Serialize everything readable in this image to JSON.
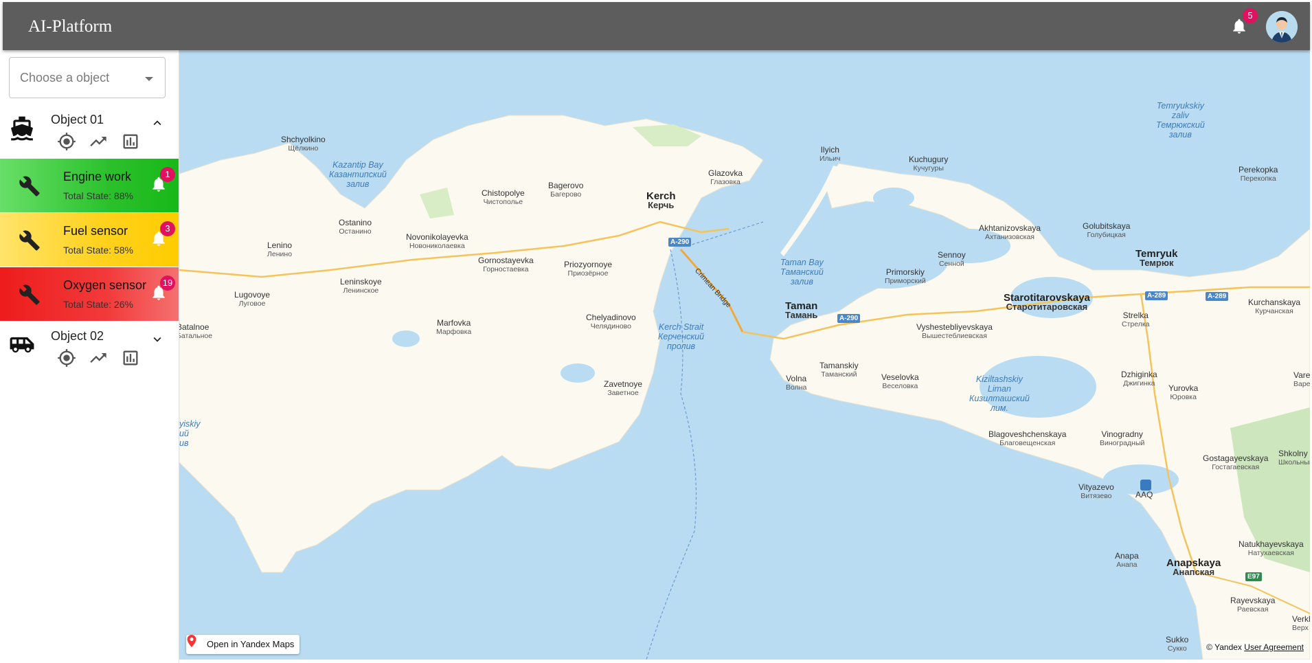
{
  "app": {
    "title": "AI-Platform",
    "notifications_count": "5"
  },
  "search": {
    "placeholder": "Choose a object"
  },
  "objects": [
    {
      "name": "Object 01",
      "icon": "ship-icon",
      "expanded": true,
      "sensors": [
        {
          "name": "Engine work",
          "state": "Total State: 88%",
          "state_value": 0.88,
          "alerts": "1",
          "color": "#2ecc40"
        },
        {
          "name": "Fuel sensor",
          "state": "Total State: 58%",
          "state_value": 0.58,
          "alerts": "3",
          "color": "#ffd21f"
        },
        {
          "name": "Oxygen sensor",
          "state": "Total State: 26%",
          "state_value": 0.26,
          "alerts": "19",
          "color": "#ee1b1b"
        }
      ]
    },
    {
      "name": "Object 02",
      "icon": "truck-icon",
      "expanded": false,
      "sensors": []
    }
  ],
  "map": {
    "open_link": "Open in Yandex Maps",
    "copyright": "© Yandex",
    "agreement": "User Agreement",
    "water_labels": [
      {
        "en": "Kazantip Bay",
        "ru1": "Казантипский",
        "ru2": "залив"
      },
      {
        "en": "Temryukskiy",
        "ru1": "zaliv",
        "ru2": "Темрюкский",
        "ru3": "залив"
      },
      {
        "en": "Taman Bay",
        "ru1": "Таманский",
        "ru2": "залив"
      },
      {
        "en": "Kerch Strait",
        "ru1": "Керченский",
        "ru2": "пролив"
      },
      {
        "en": "Kiziltashskiy",
        "ru1": "Liman",
        "ru2": "Кизилташский",
        "ru3": "лим."
      },
      {
        "en": "yiskiy",
        "ru1": "ий",
        "ru2": "ив"
      }
    ],
    "places": [
      {
        "en": "Shchyolkino",
        "ru": "Щёлкино"
      },
      {
        "en": "Glazovka",
        "ru": "Глазовка"
      },
      {
        "en": "Ilyich",
        "ru": "Ильич"
      },
      {
        "en": "Kuchugury",
        "ru": "Кучугуры"
      },
      {
        "en": "Perekopka",
        "ru": "Перекопка"
      },
      {
        "en": "Chistopolye",
        "ru": "Чистополье"
      },
      {
        "en": "Bagerovo",
        "ru": "Багерово"
      },
      {
        "en": "Ostanino",
        "ru": "Останино"
      },
      {
        "en": "Novonikolayevka",
        "ru": "Новониколаевка"
      },
      {
        "en": "Lenino",
        "ru": "Ленино"
      },
      {
        "en": "Gornostayevka",
        "ru": "Горностаевка"
      },
      {
        "en": "Priozyornoye",
        "ru": "Приозёрное"
      },
      {
        "en": "Leninskoye",
        "ru": "Ленинское"
      },
      {
        "en": "Lugovoye",
        "ru": "Луговое"
      },
      {
        "en": "Batalnoe",
        "ru": "Батальное"
      },
      {
        "en": "Marfovka",
        "ru": "Марфовка"
      },
      {
        "en": "Chelyadinovo",
        "ru": "Челядиново"
      },
      {
        "en": "Zavetnoye",
        "ru": "Заветное"
      },
      {
        "en": "Akhtanizovskaya",
        "ru": "Ахтанизовская"
      },
      {
        "en": "Golubitskaya",
        "ru": "Голубицкая"
      },
      {
        "en": "Sennoy",
        "ru": "Сенной"
      },
      {
        "en": "Primorskiy",
        "ru": "Приморский"
      },
      {
        "en": "Vyshestebliyevskaya",
        "ru": "Вышестеблиевская"
      },
      {
        "en": "Tamanskiy",
        "ru": "Таманский"
      },
      {
        "en": "Volna",
        "ru": "Волна"
      },
      {
        "en": "Veselovka",
        "ru": "Веселовка"
      },
      {
        "en": "Strelka",
        "ru": "Стрелка"
      },
      {
        "en": "Kurchanskaya",
        "ru": "Курчанская"
      },
      {
        "en": "Dzhiginka",
        "ru": "Джигинка"
      },
      {
        "en": "Yurovka",
        "ru": "Юровка"
      },
      {
        "en": "Varenikovskaya",
        "ru": "Варениковская"
      },
      {
        "en": "Blagoveshchenskaya",
        "ru": "Благовещенская"
      },
      {
        "en": "Vinogradny",
        "ru": "Виноградный"
      },
      {
        "en": "Gostagayevskaya",
        "ru": "Гостагаевская"
      },
      {
        "en": "Shkolny",
        "ru": "Школьный"
      },
      {
        "en": "Vityazevo",
        "ru": "Витязево"
      },
      {
        "en": "Natukhayevskaya",
        "ru": "Натухаевская"
      },
      {
        "en": "Anapa",
        "ru": "Анапа"
      },
      {
        "en": "Rayevskaya",
        "ru": "Раевская"
      },
      {
        "en": "Sukko",
        "ru": "Сукко"
      },
      {
        "en": "Verkh",
        "ru": "Верх"
      }
    ],
    "big_places": [
      {
        "en": "Kerch",
        "ru": "Керчь"
      },
      {
        "en": "Temryuk",
        "ru": "Темрюк"
      },
      {
        "en": "Taman",
        "ru": "Тамань"
      },
      {
        "en": "Starotitarovskaya",
        "ru": "Старотитаровская"
      },
      {
        "en": "Anapskaya",
        "ru": "Анапская"
      }
    ],
    "roads": [
      "A-290",
      "A-290",
      "A-289",
      "A-289",
      "E97"
    ],
    "bridge": "Crimean Bridge",
    "airport": "AAQ"
  }
}
